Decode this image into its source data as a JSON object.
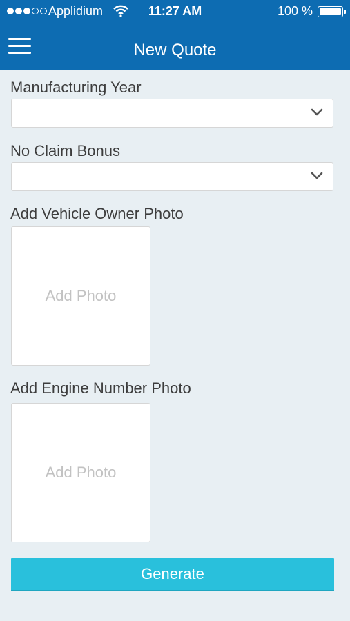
{
  "status_bar": {
    "carrier": "Applidium",
    "time": "11:27 AM",
    "battery": "100 %",
    "signal_full_dots": 3,
    "signal_total_dots": 5
  },
  "header": {
    "title": "New Quote",
    "menu_icon": "hamburger-menu-icon",
    "background_color": "#0d6cb2"
  },
  "form": {
    "manufacturing_year": {
      "label": "Manufacturing Year",
      "value": ""
    },
    "no_claim_bonus": {
      "label": "No Claim Bonus",
      "value": ""
    },
    "vehicle_owner_photo": {
      "label": "Add Vehicle Owner Photo",
      "placeholder": "Add Photo"
    },
    "engine_number_photo": {
      "label": "Add Engine Number Photo",
      "placeholder": "Add Photo"
    }
  },
  "generate_button": {
    "label": "Generate",
    "color": "#29c0dc"
  }
}
